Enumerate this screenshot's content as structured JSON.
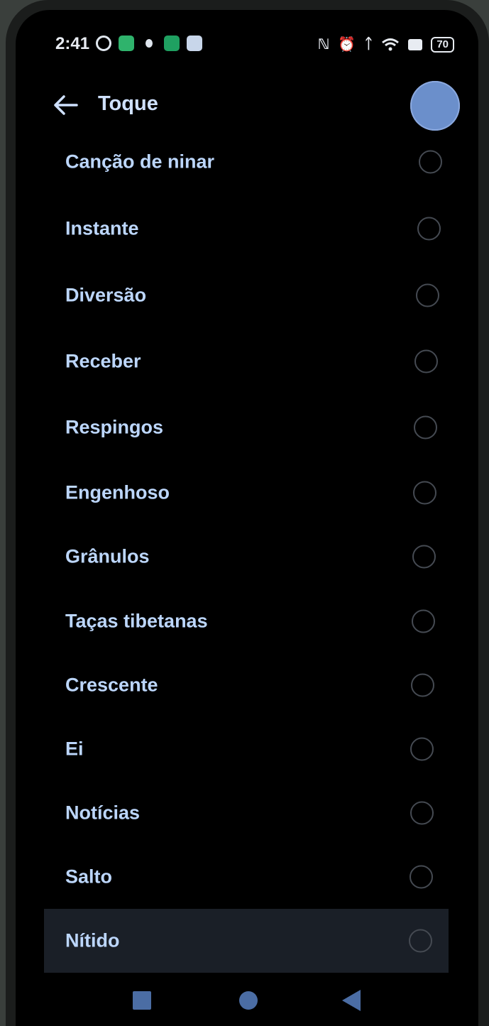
{
  "status_bar": {
    "time": "2:41",
    "battery": "70",
    "right_icons": [
      "nfc-icon",
      "alarm-icon",
      "bluetooth-icon",
      "wifi-icon",
      "sim-icon",
      "battery-icon"
    ]
  },
  "header": {
    "title": "Toque"
  },
  "ringtones": [
    {
      "label": "Canção de ninar",
      "selected": false
    },
    {
      "label": "Instante",
      "selected": false
    },
    {
      "label": "Diversão",
      "selected": false
    },
    {
      "label": "Receber",
      "selected": false
    },
    {
      "label": "Respingos",
      "selected": false
    },
    {
      "label": "Engenhoso",
      "selected": false
    },
    {
      "label": "Grânulos",
      "selected": false
    },
    {
      "label": "Taças tibetanas",
      "selected": false
    },
    {
      "label": "Crescente",
      "selected": false
    },
    {
      "label": "Ei",
      "selected": false
    },
    {
      "label": "Notícias",
      "selected": false
    },
    {
      "label": "Salto",
      "selected": false
    },
    {
      "label": "Nítido",
      "selected": false
    }
  ],
  "colors": {
    "accent": "#bcd6fb",
    "background": "#000000",
    "radio_border": "#454a52",
    "nav": "#4b6da4"
  }
}
